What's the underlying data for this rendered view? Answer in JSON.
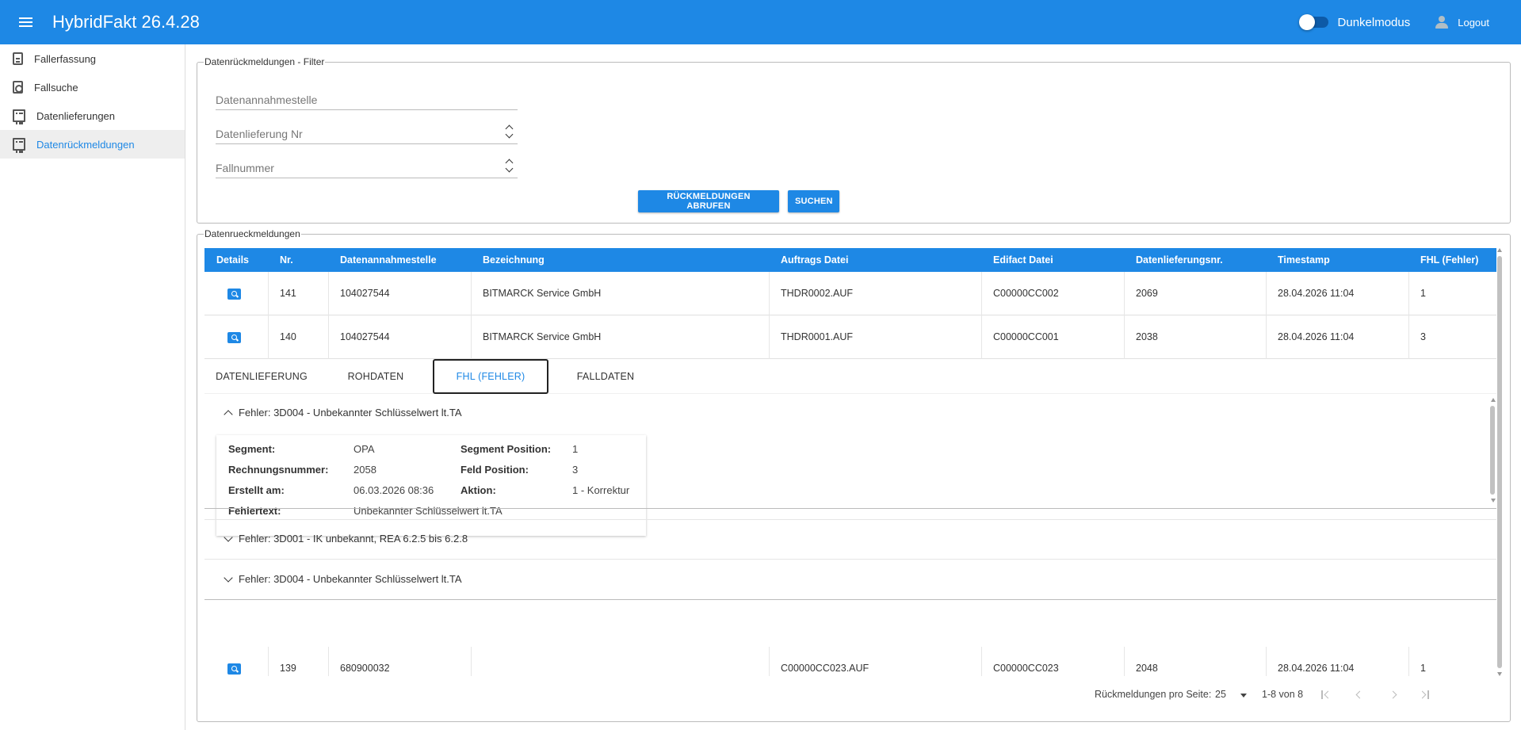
{
  "header": {
    "app_title": "HybridFakt 26.4.28",
    "dark_mode_label": "Dunkelmodus",
    "logout_label": "Logout"
  },
  "sidebar": {
    "items": [
      {
        "label": "Fallerfassung",
        "icon": "document-icon"
      },
      {
        "label": "Fallsuche",
        "icon": "search-document-icon"
      },
      {
        "label": "Datenlieferungen",
        "icon": "list-icon"
      },
      {
        "label": "Datenrückmeldungen",
        "icon": "list-icon",
        "active": true
      }
    ]
  },
  "filter": {
    "legend": "Datenrückmeldungen - Filter",
    "fields": {
      "datenannahmestelle": "Datenannahmestelle",
      "datenlieferung_nr": "Datenlieferung Nr",
      "fallnummer": "Fallnummer"
    },
    "btn_abrufen": "RÜCKMELDUNGEN ABRUFEN",
    "btn_suchen": "SUCHEN"
  },
  "results": {
    "legend": "Datenrueckmeldungen",
    "columns": [
      "Details",
      "Nr.",
      "Datenannahmestelle",
      "Bezeichnung",
      "Auftrags Datei",
      "Edifact Datei",
      "Datenlieferungsnr.",
      "Timestamp",
      "FHL (Fehler)"
    ],
    "rows": [
      {
        "nr": "141",
        "stelle": "104027544",
        "bez": "BITMARCK Service GmbH",
        "auftrag": "THDR0002.AUF",
        "edifact": "C00000CC002",
        "lief": "2069",
        "ts": "28.04.2026 11:04",
        "fhl": "1"
      },
      {
        "nr": "140",
        "stelle": "104027544",
        "bez": "BITMARCK Service GmbH",
        "auftrag": "THDR0001.AUF",
        "edifact": "C00000CC001",
        "lief": "2038",
        "ts": "28.04.2026 11:04",
        "fhl": "3"
      },
      {
        "nr": "139",
        "stelle": "680900032",
        "bez": "",
        "auftrag": "C00000CC023.AUF",
        "edifact": "C00000CC023",
        "lief": "2048",
        "ts": "28.04.2026 11:04",
        "fhl": "1"
      }
    ],
    "detail_tabs": [
      "DATENLIEFERUNG",
      "ROHDATEN",
      "FHL (FEHLER)",
      "FALLDATEN"
    ],
    "active_tab": "FHL (FEHLER)",
    "errors": [
      {
        "title": "Fehler: 3D004 - Unbekannter Schlüsselwert lt.TA",
        "expanded": true
      },
      {
        "title": "Fehler: 3D001 - IK unbekannt, REA 6.2.5 bis 6.2.8",
        "expanded": false
      },
      {
        "title": "Fehler: 3D004 - Unbekannter Schlüsselwert lt.TA",
        "expanded": false
      }
    ],
    "error_detail": {
      "segment_label": "Segment:",
      "segment": "OPA",
      "segpos_label": "Segment Position:",
      "segpos": "1",
      "rechnr_label": "Rechnungsnummer:",
      "rechnr": "2058",
      "feldpos_label": "Feld Position:",
      "feldpos": "3",
      "erstellt_label": "Erstellt am:",
      "erstellt": "06.03.2026 08:36",
      "aktion_label": "Aktion:",
      "aktion": "1 - Korrektur",
      "fehlertext_label": "Fehlertext:",
      "fehlertext": "Unbekannter Schlüsselwert lt.TA"
    },
    "pagination": {
      "per_page_label": "Rückmeldungen pro Seite:",
      "per_page": "25",
      "range": "1-8 von 8"
    }
  },
  "colors": {
    "primary": "#1e88e5",
    "active_bg": "#eeeeee"
  }
}
